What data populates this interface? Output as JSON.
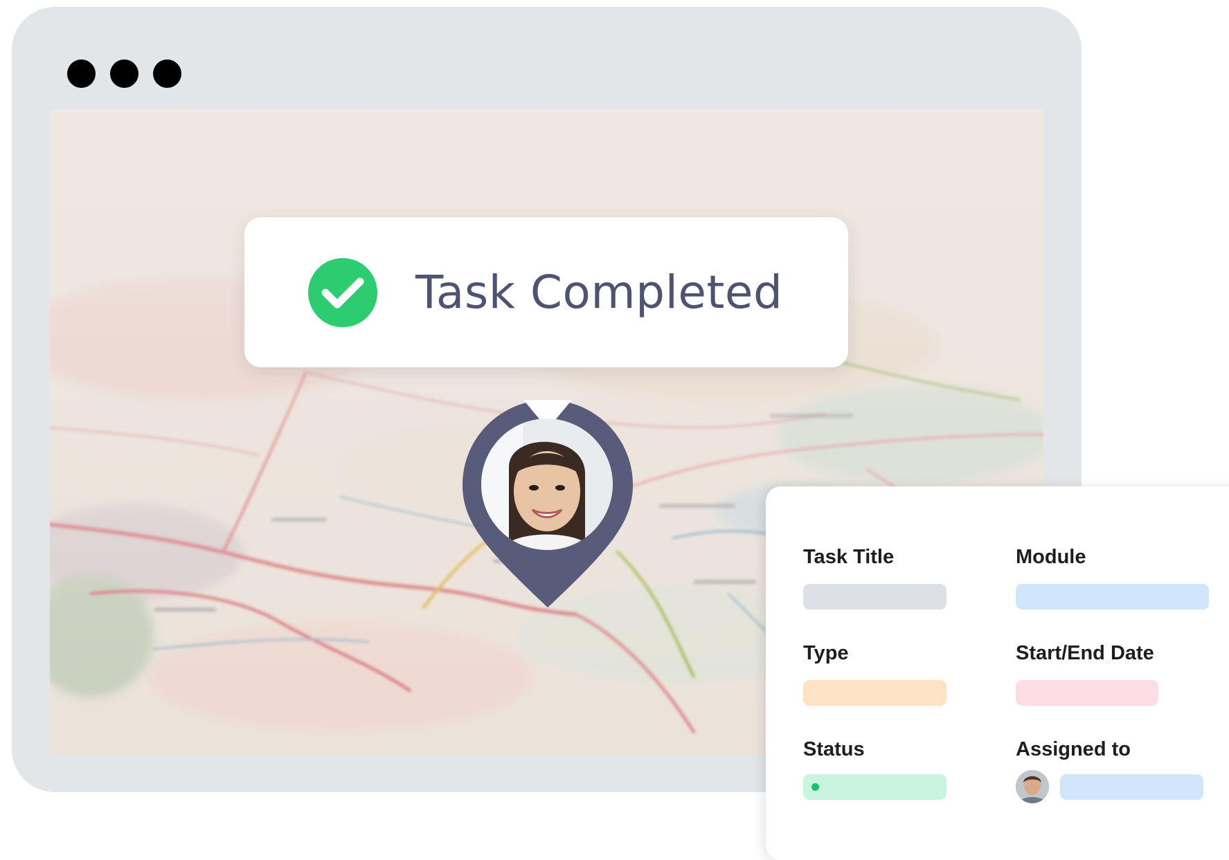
{
  "window": {
    "controls": [
      "dot",
      "dot",
      "dot"
    ]
  },
  "toast": {
    "message": "Task Completed",
    "icon": "check-circle-icon",
    "icon_color": "#2ecc71",
    "text_color": "#4f5372"
  },
  "location_pin": {
    "color": "#585b7a",
    "avatar": "user-avatar"
  },
  "task_card": {
    "fields": [
      {
        "label": "Task Title",
        "bar_color": "#dde1e6"
      },
      {
        "label": "Module",
        "bar_color": "#cfe6fb"
      },
      {
        "label": "Type",
        "bar_color": "#fde2c6"
      },
      {
        "label": "Start/End Date",
        "bar_color": "#fddde3"
      },
      {
        "label": "Status",
        "bar_color": "#c9f5e0"
      },
      {
        "label": "Assigned to",
        "bar_color": "#d2e6fb"
      }
    ]
  }
}
